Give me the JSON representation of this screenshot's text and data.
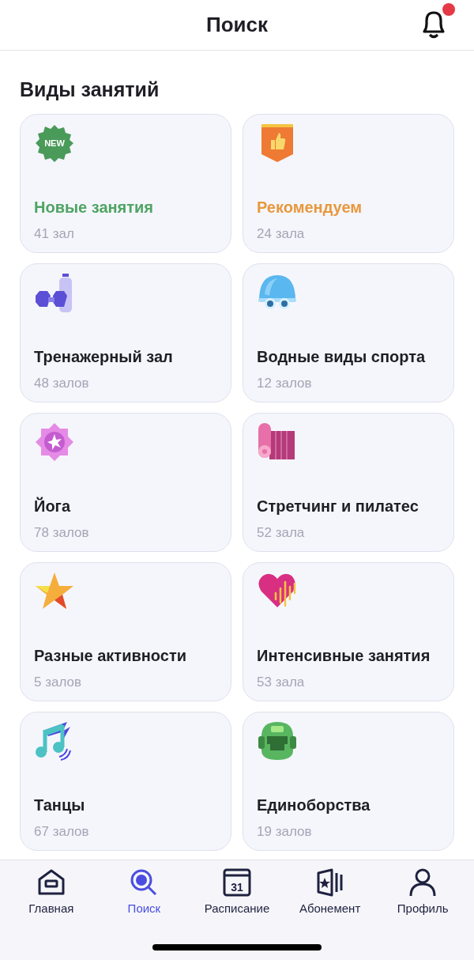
{
  "header": {
    "title": "Поиск",
    "has_notification": true
  },
  "section_title": "Виды занятий",
  "cards": [
    {
      "kind": "new",
      "badge_text": "NEW",
      "title": "Новые занятия",
      "count": "41 зал",
      "color": "#4fa463"
    },
    {
      "kind": "recommend",
      "title": "Рекомендуем",
      "count": "24 зала",
      "color": "#e8983d"
    },
    {
      "kind": "gym",
      "title": "Тренажерный зал",
      "count": "48 залов",
      "color": "#1e1e24"
    },
    {
      "kind": "swim",
      "title": "Водные виды спорта",
      "count": "12 залов",
      "color": "#1e1e24"
    },
    {
      "kind": "yoga",
      "title": "Йога",
      "count": "78 залов",
      "color": "#1e1e24"
    },
    {
      "kind": "mat",
      "title": "Стретчинг и пилатес",
      "count": "52 зала",
      "color": "#1e1e24"
    },
    {
      "kind": "star",
      "title": "Разные активности",
      "count": "5 залов",
      "color": "#1e1e24"
    },
    {
      "kind": "heart",
      "title": "Интенсивные занятия",
      "count": "53 зала",
      "color": "#1e1e24"
    },
    {
      "kind": "music",
      "title": "Танцы",
      "count": "67 залов",
      "color": "#1e1e24"
    },
    {
      "kind": "helmet",
      "title": "Единоборства",
      "count": "19 залов",
      "color": "#1e1e24"
    }
  ],
  "nav": [
    {
      "kind": "home",
      "label": "Главная",
      "selected": false
    },
    {
      "kind": "search",
      "label": "Поиск",
      "selected": true
    },
    {
      "kind": "calendar",
      "icon_text": "31",
      "label": "Расписание",
      "selected": false
    },
    {
      "kind": "pass",
      "label": "Абонемент",
      "selected": false
    },
    {
      "kind": "profile",
      "label": "Профиль",
      "selected": false
    }
  ]
}
